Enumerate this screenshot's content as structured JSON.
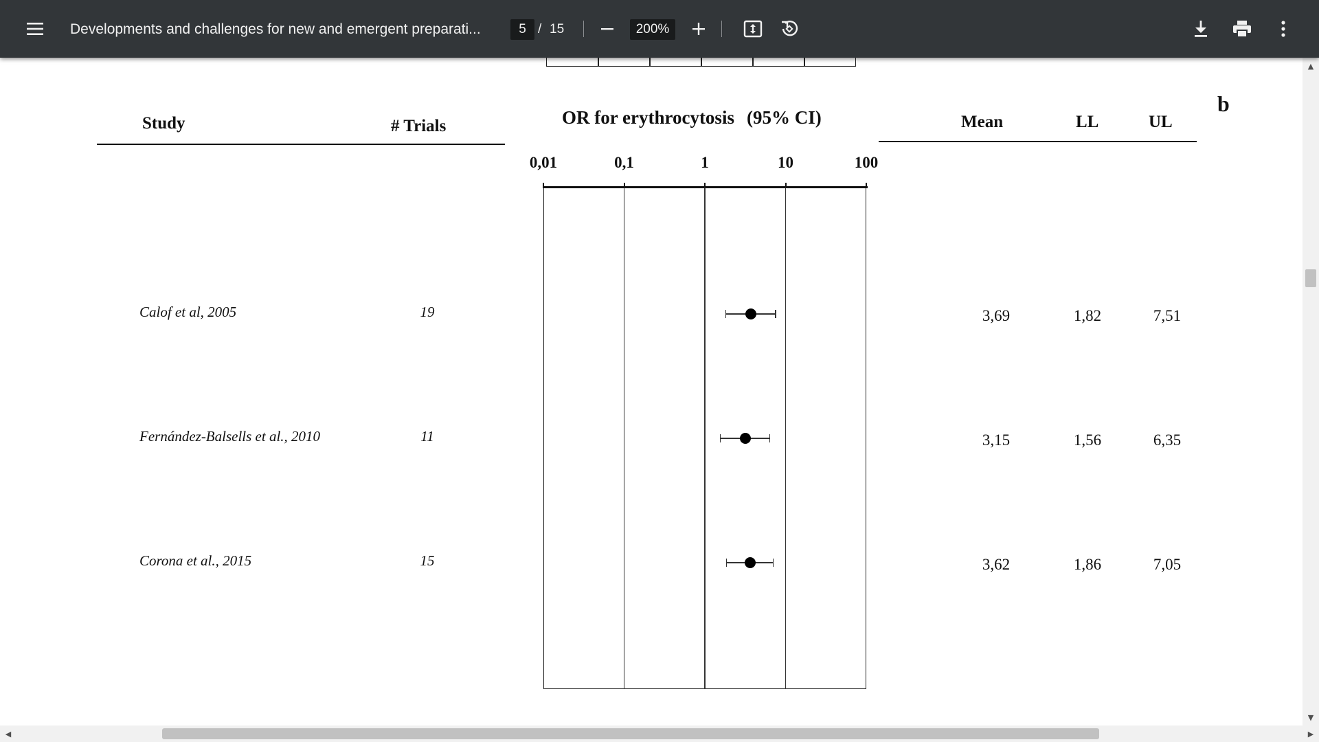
{
  "toolbar": {
    "title": "Developments and challenges for new and emergent preparati...",
    "page_current": "5",
    "page_slash": "/",
    "page_total": "15",
    "zoom": "200%",
    "icons": [
      "menu-icon",
      "zoom-out-icon",
      "zoom-in-icon",
      "fit-to-page-icon",
      "rotate-icon",
      "download-icon",
      "print-icon",
      "more-vert-icon"
    ]
  },
  "figure": {
    "panel_label": "b",
    "headers": {
      "study": "Study",
      "trials": "# Trials",
      "plot_title": "OR for erythrocytosis",
      "plot_ci": "(95% CI)",
      "mean": "Mean",
      "ll": "LL",
      "ul": "UL"
    },
    "axis_ticks": [
      "0,01",
      "0,1",
      "1",
      "10",
      "100"
    ],
    "rows": [
      {
        "study": "Calof et al, 2005",
        "trials": "19",
        "mean": "3,69",
        "ll": "1,82",
        "ul": "7,51"
      },
      {
        "study": "Fernández-Balsells et al., 2010",
        "trials": "11",
        "mean": "3,15",
        "ll": "1,56",
        "ul": "6,35"
      },
      {
        "study": "Corona et al., 2015",
        "trials": "15",
        "mean": "3,62",
        "ll": "1,86",
        "ul": "7,05"
      }
    ]
  },
  "chart_data": {
    "type": "scatter",
    "title": "OR for erythrocytosis (95% CI)",
    "x_scale": "log",
    "xlim": [
      0.01,
      100
    ],
    "x_ticks": [
      "0,01",
      "0,1",
      "1",
      "10",
      "100"
    ],
    "categories": [
      "Calof et al, 2005",
      "Fernández-Balsells et al., 2010",
      "Corona et al., 2015"
    ],
    "series": [
      {
        "values": [
          3.69,
          3.15,
          3.62
        ],
        "lower": [
          1.82,
          1.56,
          1.86
        ],
        "upper": [
          7.51,
          6.35,
          7.05
        ]
      }
    ],
    "grid": "vertical lines at ticks"
  },
  "colors": {
    "toolbar_bg": "#323639",
    "toolbar_text": "#f1f1f1",
    "input_bg": "#191b1c",
    "page_bg": "#ffffff",
    "scrollbar_track": "#f1f1f1",
    "scrollbar_thumb": "#c1c1c1"
  }
}
